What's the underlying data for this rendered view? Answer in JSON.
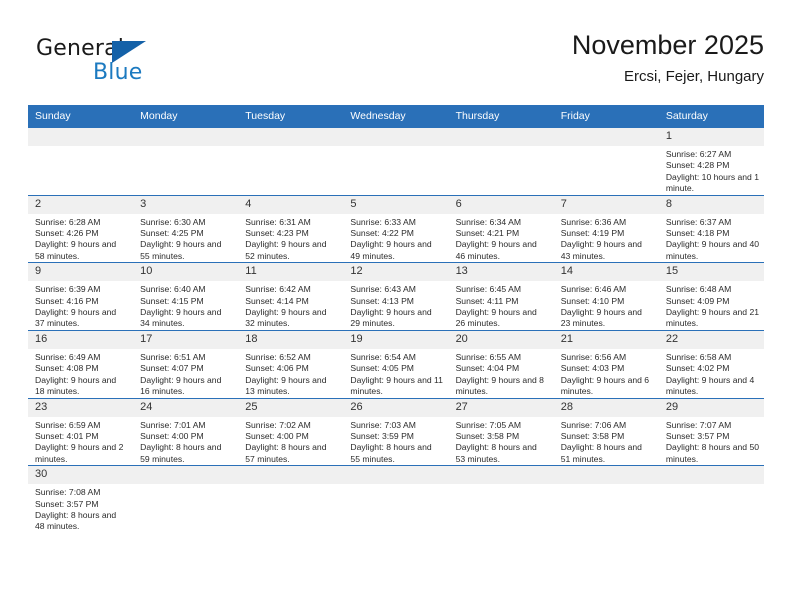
{
  "brand": {
    "name_primary": "General",
    "name_secondary": "Blue",
    "flag_icon": "triangle-flag-icon"
  },
  "header": {
    "title": "November 2025",
    "subtitle": "Ercsi, Fejer, Hungary"
  },
  "colors": {
    "header_blue": "#2a70b8",
    "brand_blue": "#1c7ac0",
    "daynum_bg": "#f0f0f0",
    "text": "#2b2b2b"
  },
  "calendar": {
    "weekday_headers": [
      "Sunday",
      "Monday",
      "Tuesday",
      "Wednesday",
      "Thursday",
      "Friday",
      "Saturday"
    ],
    "weeks": [
      [
        {
          "day": "",
          "blank": true
        },
        {
          "day": "",
          "blank": true
        },
        {
          "day": "",
          "blank": true
        },
        {
          "day": "",
          "blank": true
        },
        {
          "day": "",
          "blank": true
        },
        {
          "day": "",
          "blank": true
        },
        {
          "day": "1",
          "sunrise": "Sunrise: 6:27 AM",
          "sunset": "Sunset: 4:28 PM",
          "daylight": "Daylight: 10 hours and 1 minute."
        }
      ],
      [
        {
          "day": "2",
          "sunrise": "Sunrise: 6:28 AM",
          "sunset": "Sunset: 4:26 PM",
          "daylight": "Daylight: 9 hours and 58 minutes."
        },
        {
          "day": "3",
          "sunrise": "Sunrise: 6:30 AM",
          "sunset": "Sunset: 4:25 PM",
          "daylight": "Daylight: 9 hours and 55 minutes."
        },
        {
          "day": "4",
          "sunrise": "Sunrise: 6:31 AM",
          "sunset": "Sunset: 4:23 PM",
          "daylight": "Daylight: 9 hours and 52 minutes."
        },
        {
          "day": "5",
          "sunrise": "Sunrise: 6:33 AM",
          "sunset": "Sunset: 4:22 PM",
          "daylight": "Daylight: 9 hours and 49 minutes."
        },
        {
          "day": "6",
          "sunrise": "Sunrise: 6:34 AM",
          "sunset": "Sunset: 4:21 PM",
          "daylight": "Daylight: 9 hours and 46 minutes."
        },
        {
          "day": "7",
          "sunrise": "Sunrise: 6:36 AM",
          "sunset": "Sunset: 4:19 PM",
          "daylight": "Daylight: 9 hours and 43 minutes."
        },
        {
          "day": "8",
          "sunrise": "Sunrise: 6:37 AM",
          "sunset": "Sunset: 4:18 PM",
          "daylight": "Daylight: 9 hours and 40 minutes."
        }
      ],
      [
        {
          "day": "9",
          "sunrise": "Sunrise: 6:39 AM",
          "sunset": "Sunset: 4:16 PM",
          "daylight": "Daylight: 9 hours and 37 minutes."
        },
        {
          "day": "10",
          "sunrise": "Sunrise: 6:40 AM",
          "sunset": "Sunset: 4:15 PM",
          "daylight": "Daylight: 9 hours and 34 minutes."
        },
        {
          "day": "11",
          "sunrise": "Sunrise: 6:42 AM",
          "sunset": "Sunset: 4:14 PM",
          "daylight": "Daylight: 9 hours and 32 minutes."
        },
        {
          "day": "12",
          "sunrise": "Sunrise: 6:43 AM",
          "sunset": "Sunset: 4:13 PM",
          "daylight": "Daylight: 9 hours and 29 minutes."
        },
        {
          "day": "13",
          "sunrise": "Sunrise: 6:45 AM",
          "sunset": "Sunset: 4:11 PM",
          "daylight": "Daylight: 9 hours and 26 minutes."
        },
        {
          "day": "14",
          "sunrise": "Sunrise: 6:46 AM",
          "sunset": "Sunset: 4:10 PM",
          "daylight": "Daylight: 9 hours and 23 minutes."
        },
        {
          "day": "15",
          "sunrise": "Sunrise: 6:48 AM",
          "sunset": "Sunset: 4:09 PM",
          "daylight": "Daylight: 9 hours and 21 minutes."
        }
      ],
      [
        {
          "day": "16",
          "sunrise": "Sunrise: 6:49 AM",
          "sunset": "Sunset: 4:08 PM",
          "daylight": "Daylight: 9 hours and 18 minutes."
        },
        {
          "day": "17",
          "sunrise": "Sunrise: 6:51 AM",
          "sunset": "Sunset: 4:07 PM",
          "daylight": "Daylight: 9 hours and 16 minutes."
        },
        {
          "day": "18",
          "sunrise": "Sunrise: 6:52 AM",
          "sunset": "Sunset: 4:06 PM",
          "daylight": "Daylight: 9 hours and 13 minutes."
        },
        {
          "day": "19",
          "sunrise": "Sunrise: 6:54 AM",
          "sunset": "Sunset: 4:05 PM",
          "daylight": "Daylight: 9 hours and 11 minutes."
        },
        {
          "day": "20",
          "sunrise": "Sunrise: 6:55 AM",
          "sunset": "Sunset: 4:04 PM",
          "daylight": "Daylight: 9 hours and 8 minutes."
        },
        {
          "day": "21",
          "sunrise": "Sunrise: 6:56 AM",
          "sunset": "Sunset: 4:03 PM",
          "daylight": "Daylight: 9 hours and 6 minutes."
        },
        {
          "day": "22",
          "sunrise": "Sunrise: 6:58 AM",
          "sunset": "Sunset: 4:02 PM",
          "daylight": "Daylight: 9 hours and 4 minutes."
        }
      ],
      [
        {
          "day": "23",
          "sunrise": "Sunrise: 6:59 AM",
          "sunset": "Sunset: 4:01 PM",
          "daylight": "Daylight: 9 hours and 2 minutes."
        },
        {
          "day": "24",
          "sunrise": "Sunrise: 7:01 AM",
          "sunset": "Sunset: 4:00 PM",
          "daylight": "Daylight: 8 hours and 59 minutes."
        },
        {
          "day": "25",
          "sunrise": "Sunrise: 7:02 AM",
          "sunset": "Sunset: 4:00 PM",
          "daylight": "Daylight: 8 hours and 57 minutes."
        },
        {
          "day": "26",
          "sunrise": "Sunrise: 7:03 AM",
          "sunset": "Sunset: 3:59 PM",
          "daylight": "Daylight: 8 hours and 55 minutes."
        },
        {
          "day": "27",
          "sunrise": "Sunrise: 7:05 AM",
          "sunset": "Sunset: 3:58 PM",
          "daylight": "Daylight: 8 hours and 53 minutes."
        },
        {
          "day": "28",
          "sunrise": "Sunrise: 7:06 AM",
          "sunset": "Sunset: 3:58 PM",
          "daylight": "Daylight: 8 hours and 51 minutes."
        },
        {
          "day": "29",
          "sunrise": "Sunrise: 7:07 AM",
          "sunset": "Sunset: 3:57 PM",
          "daylight": "Daylight: 8 hours and 50 minutes."
        }
      ],
      [
        {
          "day": "30",
          "sunrise": "Sunrise: 7:08 AM",
          "sunset": "Sunset: 3:57 PM",
          "daylight": "Daylight: 8 hours and 48 minutes."
        },
        {
          "day": "",
          "blank": true
        },
        {
          "day": "",
          "blank": true
        },
        {
          "day": "",
          "blank": true
        },
        {
          "day": "",
          "blank": true
        },
        {
          "day": "",
          "blank": true
        },
        {
          "day": "",
          "blank": true
        }
      ]
    ]
  }
}
